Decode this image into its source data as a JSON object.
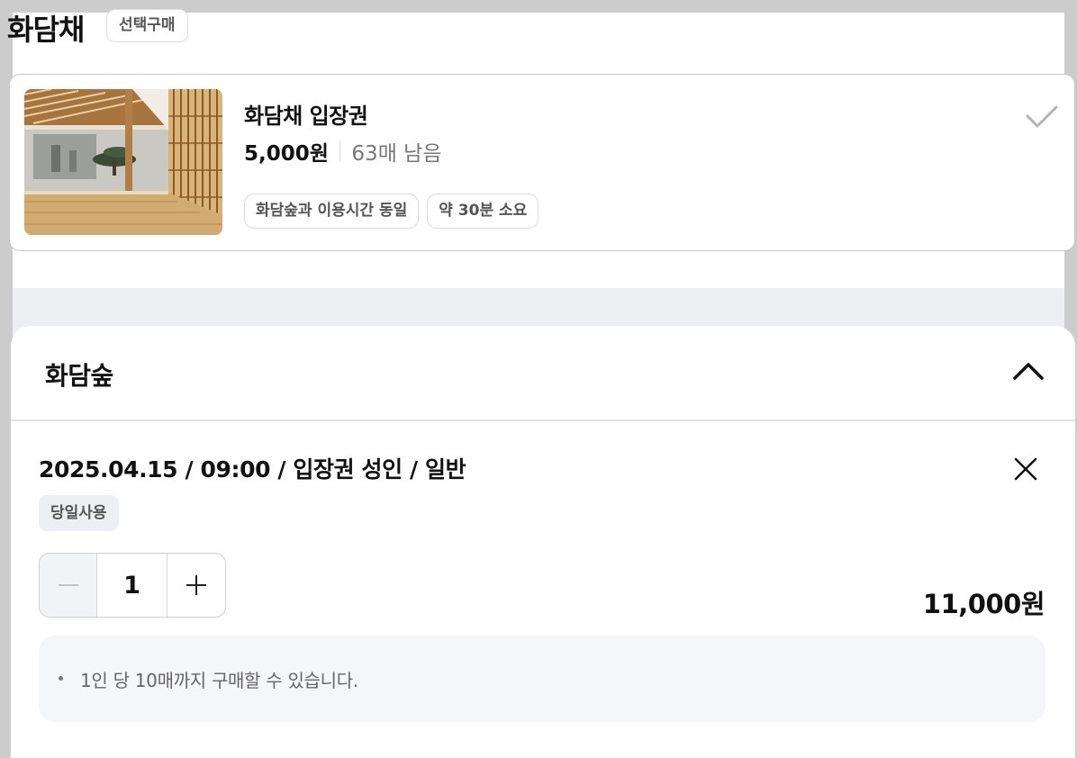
{
  "header": {
    "title": "화담채",
    "badge": "선택구매"
  },
  "ticket": {
    "name": "화담채 입장권",
    "price": "5,000원",
    "stock": "63매 남음",
    "tags": [
      "화담숲과 이용시간 동일",
      "약 30분 소요"
    ],
    "selected_icon": "checkmark-icon",
    "thumbnail": "traditional-hanok-pavilion-photo"
  },
  "sheet": {
    "title": "화담숲",
    "collapse_icon": "chevron-up-icon",
    "option": {
      "title": "2025.04.15 / 09:00 / 입장권 성인 / 일반",
      "remove_icon": "close-icon",
      "usage_badge": "당일사용",
      "quantity": "1",
      "minus_icon": "minus-icon",
      "plus_icon": "plus-icon",
      "total": "11,000원"
    },
    "notice": "1인 당 10매까지 구매할 수 있습니다."
  },
  "colors": {
    "page_background": "#cccccc",
    "sheet_background": "#ffffff",
    "notice_background": "#f5f6fa",
    "muted_text": "#777777"
  }
}
